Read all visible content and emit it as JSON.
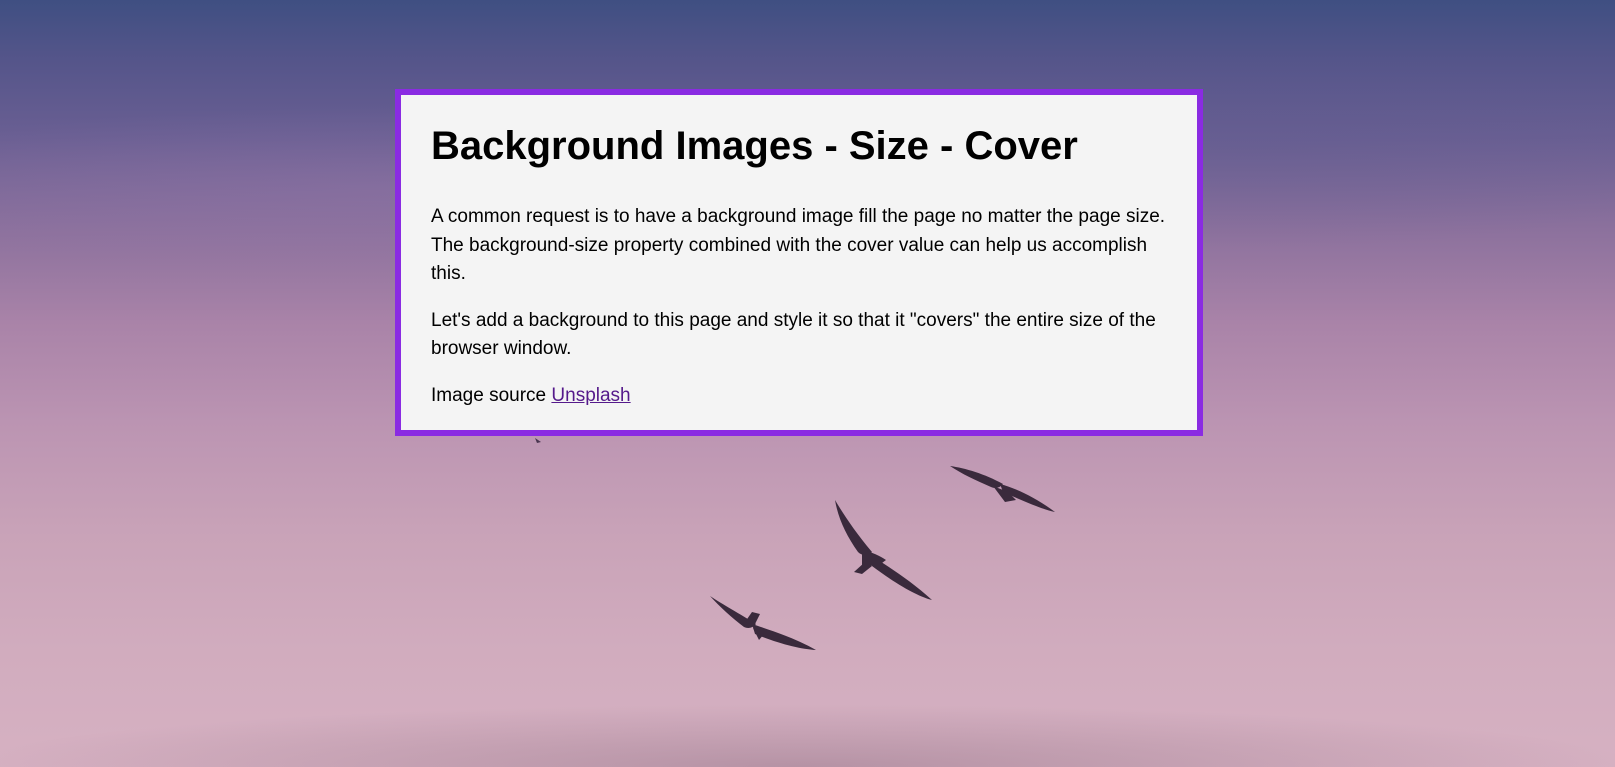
{
  "background": {
    "image_subject": "birds-flying-in-purple-sky",
    "sky_colors": [
      "#3f4f82",
      "#8c719d",
      "#d6b1c2"
    ]
  },
  "card": {
    "border_color": "#8a2be2",
    "background_color": "#f4f4f4",
    "title": "Background Images - Size - Cover",
    "paragraph_1": "A common request is to have a background image fill the page no matter the page size. The background-size property combined with the cover value can help us accomplish this.",
    "paragraph_2": "Let's add a background to this page and style it so that it \"covers\" the entire size of the browser window.",
    "source_prefix": "Image source",
    "source_link": "Unsplash",
    "link_color": "#551a8b"
  }
}
